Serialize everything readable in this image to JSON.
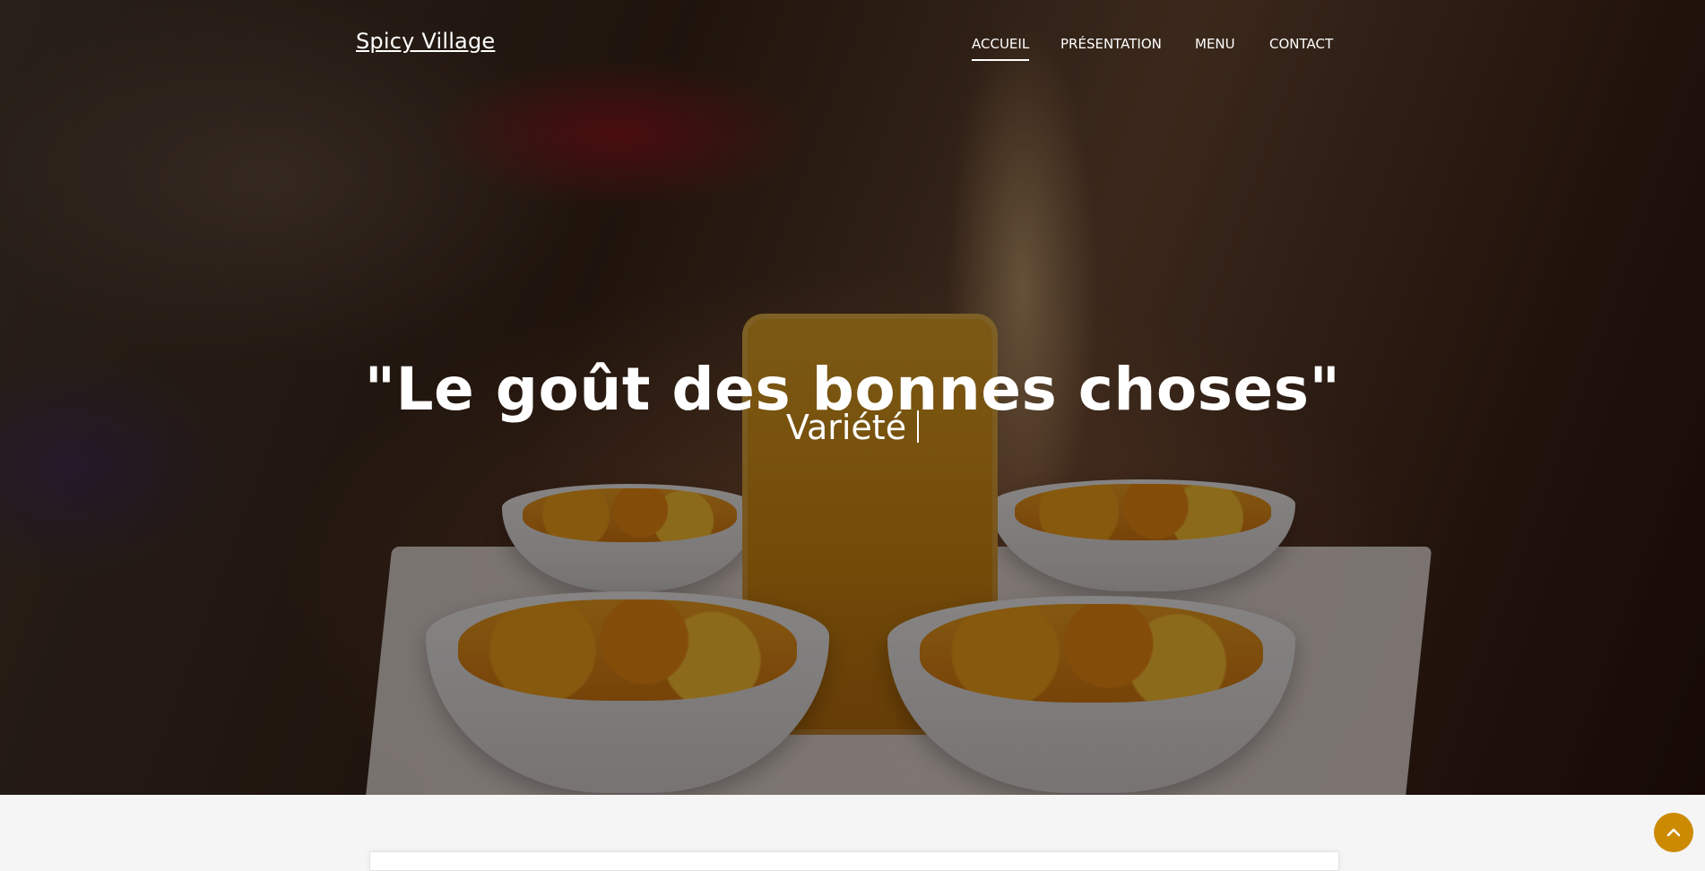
{
  "header": {
    "brand": "Spicy Village",
    "nav": [
      {
        "label": "ACCUEIL",
        "active": true
      },
      {
        "label": "PRÉSENTATION",
        "active": false
      },
      {
        "label": "MENU",
        "active": false
      },
      {
        "label": "CONTACT",
        "active": false
      }
    ]
  },
  "hero": {
    "title": "\"Le goût des bonnes choses\"",
    "subtitle": "Variété"
  },
  "back_to_top": {
    "icon": "chevron-up-icon",
    "color": "#cc8a00"
  },
  "colors": {
    "overlay": "rgba(0,0,0,0.45)",
    "page_background": "#f5f5f5",
    "accent": "#cc8a00"
  }
}
